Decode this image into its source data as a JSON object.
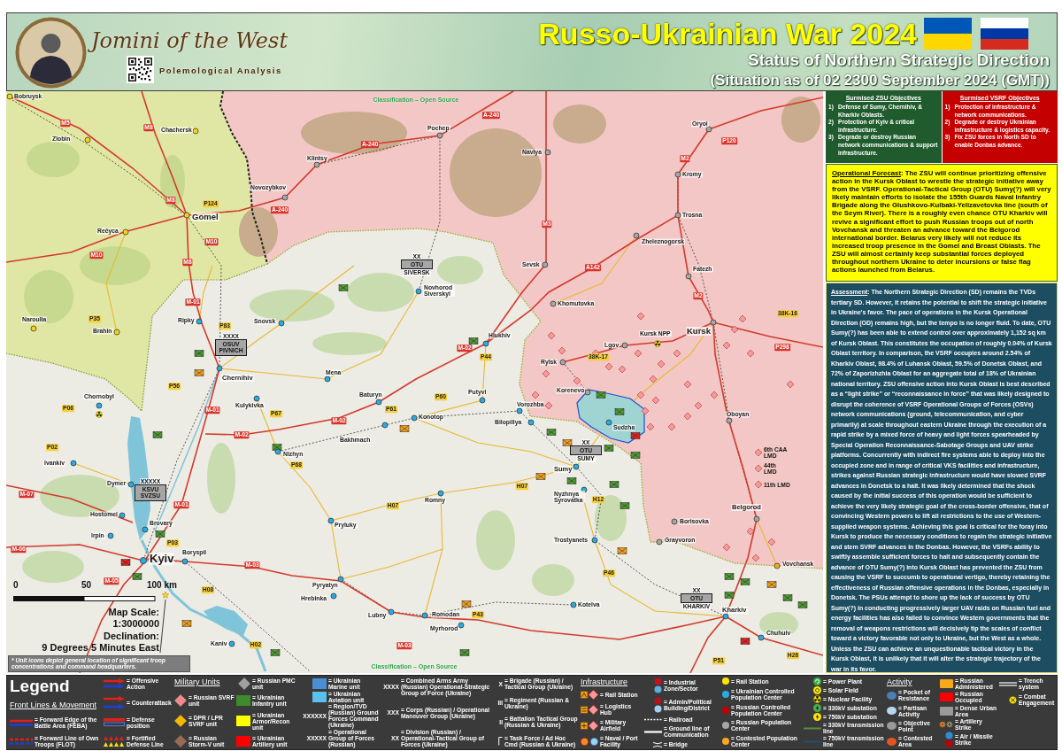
{
  "header": {
    "brand": "Jomini of the West",
    "tagline": "Polemological Analysis",
    "title": "Russo-Ukrainian War 2024",
    "subtitle": "Status of Northern Strategic Direction",
    "situation": "(Situation as of 02 2300 September 2024 (GMT))"
  },
  "map": {
    "classification": [
      "Classification – Open Source",
      "Classification – Open Source"
    ],
    "cities": [
      {
        "name": "Bobruysk",
        "color": "#f5d31c"
      },
      {
        "name": "Chachersk",
        "color": "#f5d31c"
      },
      {
        "name": "Pochep",
        "color": "#a6a6a6"
      },
      {
        "name": "Oryol",
        "color": "#a6a6a6"
      },
      {
        "name": "Zlobin",
        "color": "#f5d31c"
      },
      {
        "name": "Klintsy",
        "color": "#a6a6a6"
      },
      {
        "name": "Navlya",
        "color": "#a6a6a6"
      },
      {
        "name": "Kromy",
        "color": "#a6a6a6"
      },
      {
        "name": "Novozybkov",
        "color": "#a6a6a6"
      },
      {
        "name": "Gomel",
        "color": "#f5d31c"
      },
      {
        "name": "Trosna",
        "color": "#a6a6a6"
      },
      {
        "name": "Rečyca",
        "color": "#f5d31c"
      },
      {
        "name": "Zheleznogorsk",
        "color": "#a6a6a6"
      },
      {
        "name": "Sevsk",
        "color": "#a6a6a6"
      },
      {
        "name": "Fatezh",
        "color": "#a6a6a6"
      },
      {
        "name": "Novhorod Siverskyi",
        "color": "#29abe2"
      },
      {
        "name": "Khomutovka",
        "color": "#a6a6a6"
      },
      {
        "name": "Naroulia",
        "color": "#f5d31c"
      },
      {
        "name": "Ripky",
        "color": "#29abe2"
      },
      {
        "name": "Snovsk",
        "color": "#29abe2"
      },
      {
        "name": "Brahin",
        "color": "#f5d31c"
      },
      {
        "name": "Hlukhiv",
        "color": "#29abe2"
      },
      {
        "name": "Kursk",
        "color": "#a6a6a6"
      },
      {
        "name": "Lgov",
        "color": "#a6a6a6"
      },
      {
        "name": "Rylsk",
        "color": "#a6a6a6"
      },
      {
        "name": "Chernihiv",
        "color": "#29abe2"
      },
      {
        "name": "Mena",
        "color": "#29abe2"
      },
      {
        "name": "Chornobyl",
        "color": "#29abe2"
      },
      {
        "name": "Baturyn",
        "color": "#29abe2"
      },
      {
        "name": "Putyvl",
        "color": "#29abe2"
      },
      {
        "name": "Korenevo",
        "color": "#a6a6a6"
      },
      {
        "name": "Kulykivka",
        "color": "#29abe2"
      },
      {
        "name": "Vorozhba",
        "color": "#29abe2"
      },
      {
        "name": "Konotop",
        "color": "#29abe2"
      },
      {
        "name": "Oboyan",
        "color": "#a6a6a6"
      },
      {
        "name": "Bilopillya",
        "color": "#29abe2"
      },
      {
        "name": "Sudzha",
        "color": "#29abe2"
      },
      {
        "name": "Bakhmach",
        "color": "#29abe2"
      },
      {
        "name": "Nizhyn",
        "color": "#29abe2"
      },
      {
        "name": "Ivankiv",
        "color": "#29abe2"
      },
      {
        "name": "Sumy",
        "color": "#29abe2"
      },
      {
        "name": "Dymer",
        "color": "#29abe2"
      },
      {
        "name": "Romny",
        "color": "#29abe2"
      },
      {
        "name": "Nyzhnya Syrovatka",
        "color": "#29abe2"
      },
      {
        "name": "Belgorod",
        "color": "#a6a6a6"
      },
      {
        "name": "Hostomel",
        "color": "#29abe2"
      },
      {
        "name": "Brovary",
        "color": "#29abe2"
      },
      {
        "name": "Pryluky",
        "color": "#29abe2"
      },
      {
        "name": "Borisovka",
        "color": "#a6a6a6"
      },
      {
        "name": "Irpin",
        "color": "#29abe2"
      },
      {
        "name": "Trostyanets",
        "color": "#29abe2"
      },
      {
        "name": "Grayvoron",
        "color": "#a6a6a6"
      },
      {
        "name": "Kyiv",
        "color": "#29abe2"
      },
      {
        "name": "Boryspil",
        "color": "#29abe2"
      },
      {
        "name": "Vovchansk",
        "color": "#f7a81b"
      },
      {
        "name": "Pyryatyn",
        "color": "#29abe2"
      },
      {
        "name": "Hrebinka",
        "color": "#29abe2"
      },
      {
        "name": "Lubny",
        "color": "#29abe2"
      },
      {
        "name": "Romodan",
        "color": "#29abe2"
      },
      {
        "name": "Kotelva",
        "color": "#29abe2"
      },
      {
        "name": "Kharkiv",
        "color": "#29abe2"
      },
      {
        "name": "Myrhorod",
        "color": "#29abe2"
      },
      {
        "name": "Chuhuiv",
        "color": "#29abe2"
      },
      {
        "name": "Kaniv",
        "color": "#29abe2"
      }
    ],
    "roads": [
      {
        "label": "A-240",
        "kind": "main"
      },
      {
        "label": "M5",
        "kind": "main"
      },
      {
        "label": "M8",
        "kind": "main"
      },
      {
        "label": "A-240",
        "kind": "main"
      },
      {
        "label": "P120",
        "kind": "main"
      },
      {
        "label": "M2",
        "kind": "main"
      },
      {
        "label": "M8",
        "kind": "main"
      },
      {
        "label": "P124",
        "kind": "regional"
      },
      {
        "label": "A-240",
        "kind": "main"
      },
      {
        "label": "M3",
        "kind": "main"
      },
      {
        "label": "M10",
        "kind": "main"
      },
      {
        "label": "M10",
        "kind": "main"
      },
      {
        "label": "M8",
        "kind": "main"
      },
      {
        "label": "A142",
        "kind": "main"
      },
      {
        "label": "M-01",
        "kind": "main"
      },
      {
        "label": "M2",
        "kind": "main"
      },
      {
        "label": "P35",
        "kind": "regional"
      },
      {
        "label": "38K-16",
        "kind": "regional"
      },
      {
        "label": "P83",
        "kind": "regional"
      },
      {
        "label": "M-02",
        "kind": "main"
      },
      {
        "label": "P298",
        "kind": "main"
      },
      {
        "label": "P44",
        "kind": "regional"
      },
      {
        "label": "38K-17",
        "kind": "regional"
      },
      {
        "label": "P56",
        "kind": "regional"
      },
      {
        "label": "P60",
        "kind": "regional"
      },
      {
        "label": "P06",
        "kind": "regional"
      },
      {
        "label": "M-01",
        "kind": "main"
      },
      {
        "label": "P67",
        "kind": "regional"
      },
      {
        "label": "P61",
        "kind": "regional"
      },
      {
        "label": "M-02",
        "kind": "main"
      },
      {
        "label": "M-02",
        "kind": "main"
      },
      {
        "label": "P02",
        "kind": "regional"
      },
      {
        "label": "P68",
        "kind": "regional"
      },
      {
        "label": "H07",
        "kind": "regional"
      },
      {
        "label": "M-07",
        "kind": "main"
      },
      {
        "label": "M-01",
        "kind": "main"
      },
      {
        "label": "H07",
        "kind": "regional"
      },
      {
        "label": "H12",
        "kind": "regional"
      },
      {
        "label": "M-06",
        "kind": "main"
      },
      {
        "label": "P03",
        "kind": "regional"
      },
      {
        "label": "M-03",
        "kind": "main"
      },
      {
        "label": "P46",
        "kind": "regional"
      },
      {
        "label": "M-05",
        "kind": "main"
      },
      {
        "label": "H08",
        "kind": "regional"
      },
      {
        "label": "P43",
        "kind": "regional"
      },
      {
        "label": "H02",
        "kind": "regional"
      },
      {
        "label": "M-03",
        "kind": "main"
      },
      {
        "label": "P51",
        "kind": "regional"
      },
      {
        "label": "H26",
        "kind": "regional"
      }
    ],
    "units": [
      {
        "kind": "ukrainian",
        "echelon": "XX",
        "name": "OTU",
        "sub": "SIVERSK"
      },
      {
        "kind": "ukrainian",
        "echelon": "XXXX",
        "name": "OSUV PIVNICH"
      },
      {
        "kind": "ukrainian",
        "echelon": "XX",
        "name": "OTU",
        "sub": "SUMY"
      },
      {
        "kind": "russian",
        "name": "6th CAA LMD"
      },
      {
        "kind": "russian",
        "name": "44th LMD"
      },
      {
        "kind": "ukrainian",
        "echelon": "XXXXX",
        "name": "KSVU SVZSU"
      },
      {
        "kind": "russian",
        "name": "11th LMD"
      },
      {
        "kind": "ukrainian",
        "echelon": "XX",
        "name": "OTU",
        "sub": "KHARKIV"
      }
    ],
    "facilities": [
      {
        "kind": "nuclear",
        "name": "Kursk NPP"
      }
    ],
    "scale": [
      "0",
      "50",
      "100 km"
    ],
    "map_scale": [
      "Map Scale:",
      "1:3000000",
      "Declination:",
      "9 Degrees 5 Minutes East"
    ],
    "note": "* Unit icons depict general location of significant troop concentrations and command headquarters."
  },
  "objectives": [
    {
      "kind": "zsu",
      "title": "Surmised ZSU Objectives",
      "items": [
        {
          "number": "1)",
          "text": "Defense of Sumy, Chernihiv, & Kharkiv Oblasts."
        },
        {
          "number": "2)",
          "text": "Protection of Kyiv & critical infrastructure."
        },
        {
          "number": "3)",
          "text": "Degrade or destroy Russian network communications & support infrastructure."
        }
      ]
    },
    {
      "kind": "vsrf",
      "title": "Surmised VSRF Objectives",
      "items": [
        {
          "number": "1)",
          "text": "Protection of infrastructure & network communications."
        },
        {
          "number": "2)",
          "text": "Degrade or destroy Ukrainian infrastructure & logistics capacity."
        },
        {
          "number": "3)",
          "text": "Fix ZSU forces in North SD to enable Donbas advance."
        }
      ]
    }
  ],
  "forecast": {
    "heading": "Operational Forecast",
    "text": ": The ZSU will continue prioritizing offensive action in the Kursk Oblast to wrestle the strategic initiative away from the VSRF. Operational-Tactical Group (OTU) Sumy(?) will very likely maintain efforts to isolate the 155th Guards Naval Infantry Brigade along the Glushkovo-Kulbaki-Yelizavetovka line (south of the Seym River). There is a roughly even chance OTU Kharkiv will revive a significant effort to push Russian troops out of north Vovchansk and threaten an advance toward the Belgorod international border. Belarus very likely will not reduce its increased troop presence in the Gomel and Breast Oblasts. The ZSU will almost certainly keep substantial forces deployed throughout northern Ukraine to deter incursions or false flag actions launched from Belarus."
  },
  "assessment": {
    "heading": "Assessment",
    "text": ": The Northern Strategic Direction (SD) remains the TVDs tertiary SD. However, it retains the potential to shift the strategic initiative in Ukraine's favor. The pace of operations in the Kursk Operational Direction (OD) remains high, but the tempo is no longer fluid. To date, OTU Sumy(?) has been able to extend control over approximately 1,152 sq km of Kursk Oblast. This constitutes the occupation of roughly 0.04% of Kursk Oblast territory. In comparison, the VSRF occupies around 2.54% of Kharkiv Oblast, 98.4% of Luhansk Oblast, 59.5% of Donetsk Oblast, and 72% of Zaporizhzhia Oblast for an aggregate total of 18% of Ukrainian national territory. ZSU offensive action into Kursk Oblast is best described as a “light strike” or “reconnaissance in force” that was likely designed to disrupt the coherence of VSRF Operational Groups of Forces (OSVs) network communications (ground, telecommunication, and cyber primarily) at scale throughout eastern Ukraine through the execution of a rapid strike by a mixed force of heavy and light forces spearheaded by Special Operation Reconnaissance-Sabotage Groups and UAV strike platforms. Concurrently with indirect fire systems able to deploy into the occupied zone and in range of critical VKS facilities and infrastructure, strikes against Russian strategic infrastructure would have slowed SVRF advances in Donetsk to a halt. It was likely determined that the shock caused by the initial success of this operation would be sufficient to achieve the very likely strategic goal of the cross-border offensive, that of convincing Western powers to lift all restrictions to the use of Western-supplied weapon systems. Achieving this goal is critical for the foray into Kursk to produce the necessary conditions to regain the strategic initiative and stem SVRF advances in the Donbas. However, the VSRFs ability to swiftly assemble sufficient forces to halt and subsequently contain the advance of OTU Sumy(?) into Kursk Oblast has prevented the ZSU from causing the VSRF to succumb to operational vertigo, thereby retaining the effectiveness of Russian offensive operations in the Donbas, especially in Donetsk. The PSUs attempt to shore up the lack of success by OTU Sumy(?) in conducting progressively larger UAV raids on Russian fuel and energy facilities has also failed to convince Western governments that the removal of weapons restrictions will decisively tip the scales of conflict toward a victory favorable not only to Ukraine, but the West as a whole. Unless the ZSU can achieve an unquestionable tactical victory in the Kursk Oblast, it is unlikely that it will alter the strategic trajectory of the war in its favor."
  },
  "legend": {
    "title": "Legend",
    "columns": [
      {
        "heading": "Front Lines & Movement",
        "items": [
          {
            "kind": "feba",
            "label": "= Forward Edge of the Battle Area (FEBA)"
          },
          {
            "kind": "flot",
            "label": "= Forward Line of Own Troops (FLOT)"
          }
        ]
      },
      {
        "items": [
          {
            "kind": "offensive",
            "label": "= Offensive Action"
          },
          {
            "kind": "counterattack",
            "label": "= Counterattack"
          },
          {
            "kind": "defense",
            "label": "= Defense position"
          },
          {
            "kind": "fortified",
            "label": "= Fortified Defense Line"
          }
        ]
      },
      {
        "heading": "Military Units",
        "items": [
          {
            "kind": "diamond",
            "color": "#f08a8a",
            "label": "= Russian SVRF unit"
          },
          {
            "kind": "diamond",
            "color": "#f5b800",
            "label": "= DPR / LPR SVRF unit"
          },
          {
            "kind": "diamond",
            "color": "#9b6a55",
            "label": "= Russian Storm-V unit"
          }
        ]
      },
      {
        "items": [
          {
            "kind": "diamond",
            "color": "#a0a0a0",
            "label": "= Russian PMC unit"
          },
          {
            "kind": "square",
            "color": "#3d8b2a",
            "label": "= Ukrainian Infantry unit"
          },
          {
            "kind": "square",
            "color": "#ffff00",
            "label": "= Ukrainian Armor/Recon unit"
          },
          {
            "kind": "square",
            "color": "#ff0000",
            "label": "= Ukrainian Artillery unit"
          }
        ]
      },
      {
        "items": [
          {
            "kind": "square",
            "color": "#4a8fd4",
            "label": "= Ukrainian Marine unit"
          },
          {
            "kind": "square",
            "color": "#5bc0eb",
            "label": "= Ukrainian Aviation unit"
          },
          {
            "kind": "echelon",
            "symbol": "XXXXXX",
            "label": "= Region/TVD (Russian) Ground Forces Command (Ukraine)"
          },
          {
            "kind": "echelon",
            "symbol": "XXXXX",
            "label": "= Operational Group of Forces (Russian)"
          }
        ]
      },
      {
        "items": [
          {
            "kind": "echelon",
            "symbol": "XXXX",
            "label": "= Combined Arms Army (Russian) Operational-Strategic Group of Force (Ukraine)"
          },
          {
            "kind": "echelon",
            "symbol": "XXX",
            "label": "= Corps (Russian) / Operational Maneuver Group (Ukraine)"
          },
          {
            "kind": "echelon",
            "symbol": "XX",
            "label": "= Division (Russian) / Operational-Tactical Group of Forces (Ukraine)"
          }
        ]
      },
      {
        "items": [
          {
            "kind": "echelon",
            "symbol": "X",
            "label": "= Brigade (Russian) / Tactical Group (Ukraine)"
          },
          {
            "kind": "echelon",
            "symbol": "III",
            "label": "= Regiment (Russian & Ukraine)"
          },
          {
            "kind": "echelon",
            "symbol": "II",
            "label": "= Battalion Tactical Group (Russian & Ukraine)"
          },
          {
            "kind": "task-force",
            "label": "= Task Force / Ad Hoc Cmd (Russian & Ukraine)"
          }
        ]
      },
      {
        "heading": "Infrastructure",
        "items": [
          {
            "kind": "rail-station",
            "label": "= Rail Station"
          },
          {
            "kind": "logistics-hub",
            "label": "= Logistics Hub"
          },
          {
            "kind": "airfield",
            "label": "= Military Airfield"
          },
          {
            "kind": "port",
            "label": "= Naval / Port Facility"
          }
        ]
      },
      {
        "items": [
          {
            "kind": "industrial",
            "label": "= Industrial Zone/Sector"
          },
          {
            "kind": "admin",
            "label": "= Admin/Political Building/District"
          },
          {
            "kind": "railroad",
            "label": "= Railroad"
          },
          {
            "kind": "gloc",
            "label": "= Ground line of Communication"
          },
          {
            "kind": "bridge",
            "label": "= Bridge"
          }
        ]
      },
      {
        "items": [
          {
            "kind": "dot",
            "color": "#ffe600",
            "label": "= Rail Station"
          },
          {
            "kind": "dot",
            "color": "#29abe2",
            "label": "= Ukrainian Controlled Population Center"
          },
          {
            "kind": "dot",
            "color": "#c00000",
            "label": "= Russian Controlled Population Center"
          },
          {
            "kind": "dot",
            "color": "#a6a6a6",
            "label": "= Russian Population Center"
          },
          {
            "kind": "dot",
            "color": "#f7a81b",
            "label": "= Contested Population Center"
          }
        ]
      },
      {
        "items": [
          {
            "kind": "power-plant",
            "label": "= Power Plant"
          },
          {
            "kind": "solar",
            "label": "= Solar Field"
          },
          {
            "kind": "nuclear",
            "label": "= Nuclear Facility"
          },
          {
            "kind": "substation",
            "color": "#4caf50",
            "label": "= 330kV substation"
          },
          {
            "kind": "substation",
            "color": "#ffe600",
            "label": "= 750kV substation"
          },
          {
            "kind": "line",
            "color": "#5b8f3a",
            "label": "= 330kV transmission line"
          },
          {
            "kind": "line",
            "color": "#1f4e6e",
            "label": "= 750kV transmission line"
          }
        ]
      },
      {
        "heading": "Activity",
        "items": [
          {
            "kind": "blob",
            "color": "#4a7fb5",
            "label": "= Pocket of Resistance"
          },
          {
            "kind": "blob",
            "color": "#b6d7f0",
            "label": "= Partisan Activity"
          },
          {
            "kind": "blob",
            "color": "#9a9a9a",
            "label": "= Objective Point"
          },
          {
            "kind": "blob",
            "color": "#e2571e",
            "label": "= Contested Area"
          }
        ]
      },
      {
        "items": [
          {
            "kind": "area",
            "color": "#f7a81b",
            "label": "= Russian Administered"
          },
          {
            "kind": "area",
            "color": "#ff0000",
            "label": "= Russian Occupied"
          },
          {
            "kind": "area",
            "color": "#9a9a9a",
            "label": "= Dense Urban Area"
          },
          {
            "kind": "artillery",
            "label": "= Artillery Strike"
          },
          {
            "kind": "air-strike",
            "label": "= Air / Missile Strike"
          }
        ]
      },
      {
        "items": [
          {
            "kind": "trench",
            "label": "= Trench system"
          },
          {
            "kind": "engagement",
            "label": "= Combat Engagement"
          }
        ]
      }
    ]
  }
}
